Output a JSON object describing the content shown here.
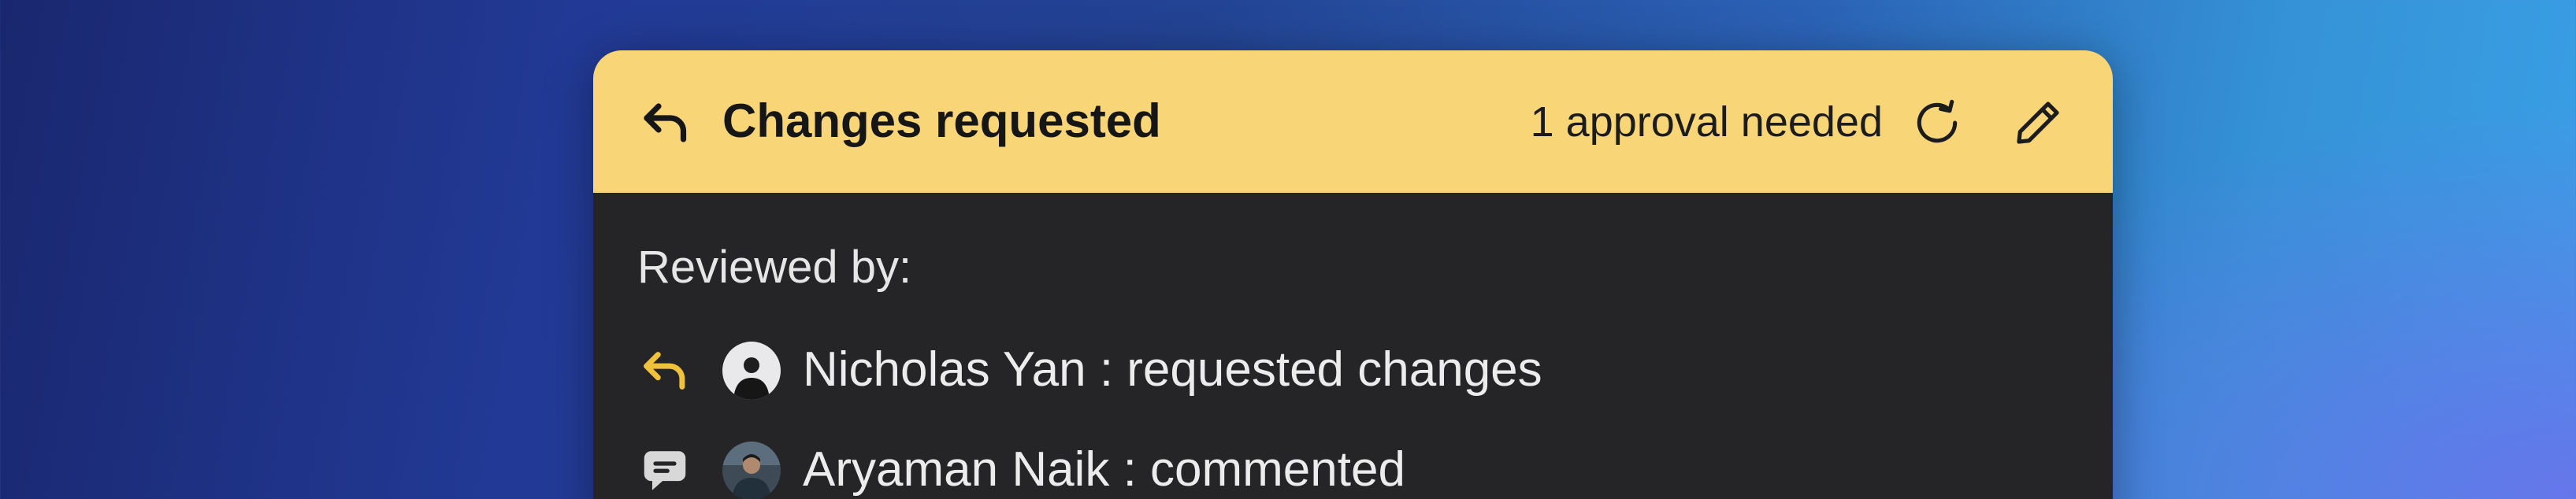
{
  "header": {
    "title": "Changes requested",
    "approval_status": "1 approval needed",
    "status_icon": "reply-arrow-icon",
    "refresh_icon": "refresh-icon",
    "edit_icon": "pencil-icon",
    "background_color": "#f8d677"
  },
  "body": {
    "label": "Reviewed by:",
    "background_color": "#252528",
    "reviewers": [
      {
        "name": "Nicholas Yan",
        "text": "Nicholas Yan : requested changes",
        "status_icon": "reply-arrow-icon",
        "status_color": "#f0c23c",
        "avatar": "avatar"
      },
      {
        "name": "Aryaman Naik",
        "text": "Aryaman Naik : commented",
        "status_icon": "comment-icon",
        "status_color": "#d8d8d8",
        "avatar": "avatar"
      }
    ]
  }
}
